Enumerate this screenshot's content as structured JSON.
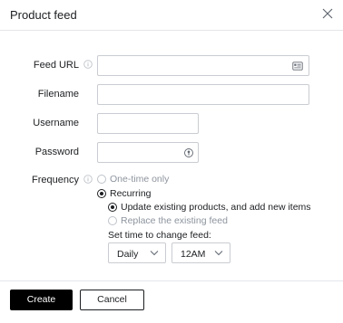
{
  "dialog": {
    "title": "Product feed"
  },
  "form": {
    "feed_url": {
      "label": "Feed URL",
      "value": ""
    },
    "filename": {
      "label": "Filename",
      "value": ""
    },
    "username": {
      "label": "Username",
      "value": ""
    },
    "password": {
      "label": "Password",
      "value": ""
    },
    "frequency": {
      "label": "Frequency",
      "options": [
        {
          "label": "One-time only",
          "selected": false,
          "disabled": true
        },
        {
          "label": "Recurring",
          "selected": true,
          "disabled": false
        }
      ],
      "recurring_options": [
        {
          "label": "Update existing products, and add new items",
          "selected": true,
          "disabled": false
        },
        {
          "label": "Replace the existing feed",
          "selected": false,
          "disabled": true
        }
      ],
      "schedule": {
        "label": "Set time to change feed:",
        "interval": "Daily",
        "time": "12AM"
      }
    }
  },
  "footer": {
    "create_label": "Create",
    "cancel_label": "Cancel"
  },
  "icons": {
    "info": "info-icon",
    "list": "list-card-icon",
    "reveal": "key-icon",
    "close": "close-icon",
    "chevron": "chevron-down-icon"
  }
}
